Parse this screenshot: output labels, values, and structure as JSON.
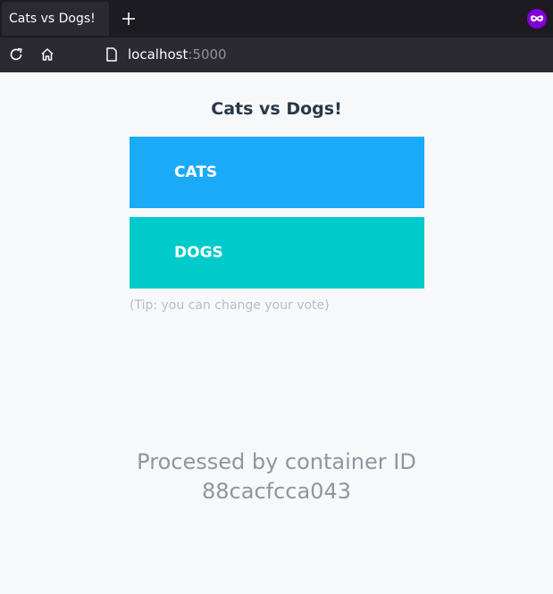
{
  "browser": {
    "tab_title": "Cats vs Dogs!",
    "url_host": "localhost",
    "url_port": ":5000"
  },
  "page": {
    "title": "Cats vs Dogs!",
    "option_a": "CATS",
    "option_b": "DOGS",
    "tip": "(Tip: you can change your vote)",
    "processed_label": "Processed by container ID",
    "container_id": "88cacfcca043"
  },
  "colors": {
    "cats_button": "#1aaaf8",
    "dogs_button": "#00cbca",
    "title": "#26394a",
    "private_badge": "#8000d7"
  },
  "icons": [
    "plus-icon",
    "private-browsing-icon",
    "reload-icon",
    "home-icon",
    "page-icon"
  ]
}
